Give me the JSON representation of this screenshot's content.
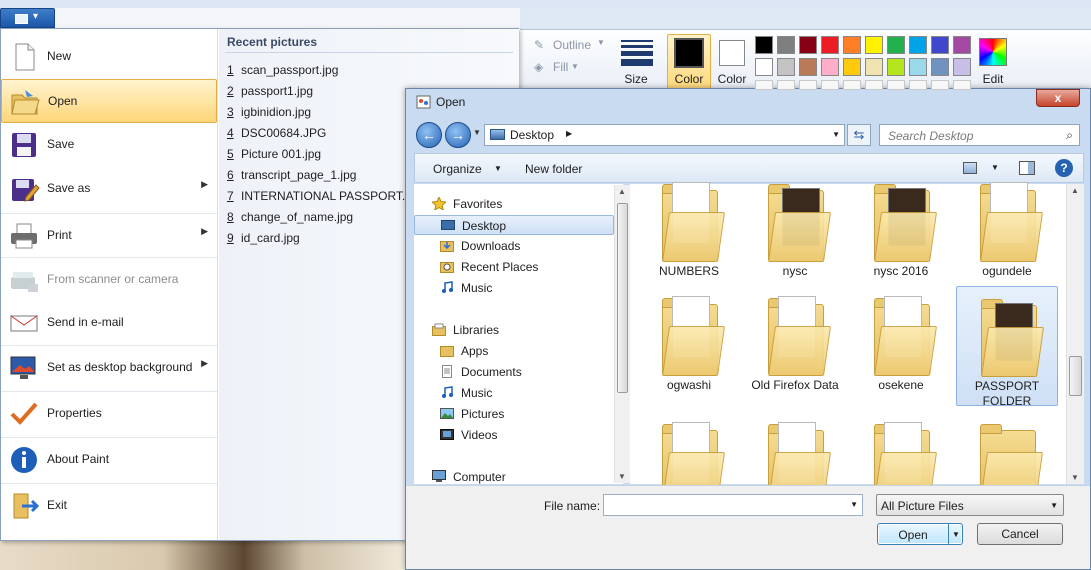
{
  "ribbon": {
    "outline_label": "Outline",
    "fill_label": "Fill",
    "size_label": "Size",
    "color1_label": "Color",
    "color2_label": "Color",
    "edit_colors_label": "Edit",
    "palette_row1": [
      "#000000",
      "#7f7f7f",
      "#880015",
      "#ed1c24",
      "#ff7f27",
      "#fff200",
      "#22b14c",
      "#00a2e8",
      "#3f48cc",
      "#a349a4"
    ],
    "palette_row2": [
      "#ffffff",
      "#c3c3c3",
      "#b97a57",
      "#ffaec9",
      "#ffc90e",
      "#efe4b0",
      "#b5e61d",
      "#99d9ea",
      "#7092be",
      "#c8bfe7"
    ]
  },
  "app_menu": {
    "items": [
      {
        "label": "New",
        "icon": "new-file-icon"
      },
      {
        "label": "Open",
        "icon": "open-folder-icon"
      },
      {
        "label": "Save",
        "icon": "floppy-disk-icon"
      },
      {
        "label": "Save as",
        "icon": "save-as-icon"
      },
      {
        "label": "Print",
        "icon": "printer-icon"
      },
      {
        "label": "From scanner or camera",
        "icon": "scanner-icon"
      },
      {
        "label": "Send in e-mail",
        "icon": "email-icon"
      },
      {
        "label": "Set as desktop background",
        "icon": "desktop-background-icon"
      },
      {
        "label": "Properties",
        "icon": "checkmark-icon"
      },
      {
        "label": "About Paint",
        "icon": "info-icon"
      },
      {
        "label": "Exit",
        "icon": "exit-icon"
      }
    ],
    "recent_title": "Recent pictures",
    "recent": [
      {
        "num": "1",
        "name": "scan_passport.jpg"
      },
      {
        "num": "2",
        "name": "passport1.jpg"
      },
      {
        "num": "3",
        "name": "igbinidion.jpg"
      },
      {
        "num": "4",
        "name": "DSC00684.JPG"
      },
      {
        "num": "5",
        "name": "Picture 001.jpg"
      },
      {
        "num": "6",
        "name": "transcript_page_1.jpg"
      },
      {
        "num": "7",
        "name": "INTERNATIONAL PASSPORT.jpg"
      },
      {
        "num": "8",
        "name": "change_of_name.jpg"
      },
      {
        "num": "9",
        "name": "id_card.jpg"
      }
    ]
  },
  "dialog": {
    "title": "Open",
    "close_glyph": "x",
    "address": "Desktop",
    "search_placeholder": "Search Desktop",
    "organize_label": "Organize",
    "new_folder_label": "New folder",
    "nav": [
      {
        "label": "Favorites",
        "icon": "star-icon",
        "indent": 0
      },
      {
        "label": "Desktop",
        "icon": "desktop-icon",
        "indent": 1,
        "selected": true
      },
      {
        "label": "Downloads",
        "icon": "downloads-icon",
        "indent": 1
      },
      {
        "label": "Recent Places",
        "icon": "recent-places-icon",
        "indent": 1
      },
      {
        "label": "Music",
        "icon": "music-icon",
        "indent": 1
      },
      {
        "label": "Libraries",
        "icon": "libraries-icon",
        "indent": 0
      },
      {
        "label": "Apps",
        "icon": "apps-icon",
        "indent": 1
      },
      {
        "label": "Documents",
        "icon": "documents-icon",
        "indent": 1
      },
      {
        "label": "Music",
        "icon": "music-icon",
        "indent": 1
      },
      {
        "label": "Pictures",
        "icon": "pictures-icon",
        "indent": 1
      },
      {
        "label": "Videos",
        "icon": "videos-icon",
        "indent": 1
      },
      {
        "label": "Computer",
        "icon": "computer-icon",
        "indent": 0
      }
    ],
    "files": [
      {
        "name": "NUMBERS",
        "content": "paper"
      },
      {
        "name": "nysc",
        "content": "photo"
      },
      {
        "name": "nysc 2016",
        "content": "photo"
      },
      {
        "name": "ogundele",
        "content": "paper"
      },
      {
        "name": "ogwashi",
        "content": "paper"
      },
      {
        "name": "Old Firefox Data",
        "content": "paper"
      },
      {
        "name": "osekene",
        "content": "paper"
      },
      {
        "name": "PASSPORT FOLDER",
        "content": "photo",
        "selected": true
      },
      {
        "name": "",
        "content": "paper"
      },
      {
        "name": "",
        "content": "paper"
      },
      {
        "name": "",
        "content": "paper"
      },
      {
        "name": "",
        "content": "none"
      }
    ],
    "file_name_label": "File name:",
    "file_name_value": "",
    "filter_value": "All Picture Files",
    "open_label": "Open",
    "cancel_label": "Cancel"
  }
}
